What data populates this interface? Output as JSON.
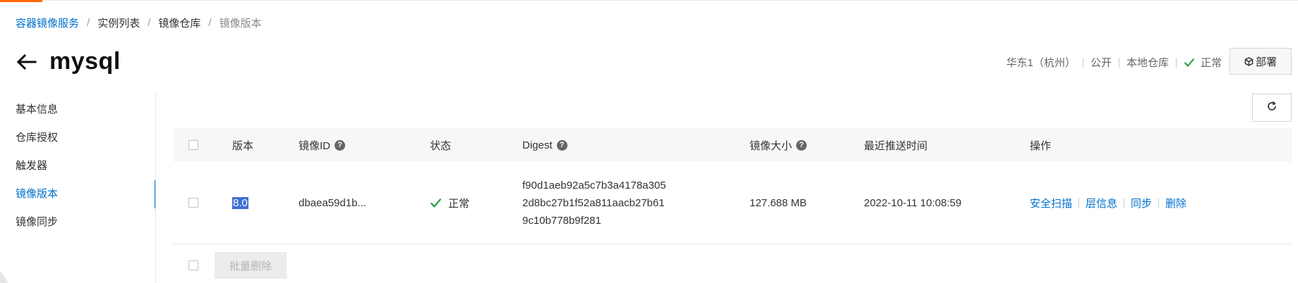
{
  "breadcrumb": {
    "items": [
      "容器镜像服务",
      "实例列表",
      "镜像仓库",
      "镜像版本"
    ]
  },
  "page": {
    "title": "mysql"
  },
  "header_meta": {
    "region": "华东1（杭州）",
    "visibility": "公开",
    "repo_type": "本地仓库",
    "status": "正常",
    "deploy_label": "部署"
  },
  "sidebar": {
    "items": [
      {
        "label": "基本信息",
        "active": false
      },
      {
        "label": "仓库授权",
        "active": false
      },
      {
        "label": "触发器",
        "active": false
      },
      {
        "label": "镜像版本",
        "active": true
      },
      {
        "label": "镜像同步",
        "active": false
      }
    ]
  },
  "table": {
    "columns": {
      "version": "版本",
      "image_id": "镜像ID",
      "status": "状态",
      "digest": "Digest",
      "size": "镜像大小",
      "pushed": "最近推送时间",
      "actions": "操作"
    },
    "rows": [
      {
        "version": "8.0",
        "image_id": "dbaea59d1b...",
        "status": "正常",
        "digest_lines": [
          "f90d1aeb92a5c7b3a4178a305",
          "2d8bc27b1f52a811aacb27b61",
          "9c10b778b9f281"
        ],
        "size": "127.688 MB",
        "pushed": "2022-10-11 10:08:59",
        "actions": [
          "安全扫描",
          "层信息",
          "同步",
          "删除"
        ]
      }
    ]
  },
  "footer": {
    "batch_delete_label": "批量删除"
  },
  "colors": {
    "accent": "#0070cc",
    "success": "#1e9e3e",
    "brand_orange": "#ff6a00"
  },
  "icons": {
    "back": "arrow-left-icon",
    "status_ok": "check-icon",
    "deploy": "cube-icon",
    "refresh": "refresh-icon",
    "help": "question-circle-icon"
  }
}
